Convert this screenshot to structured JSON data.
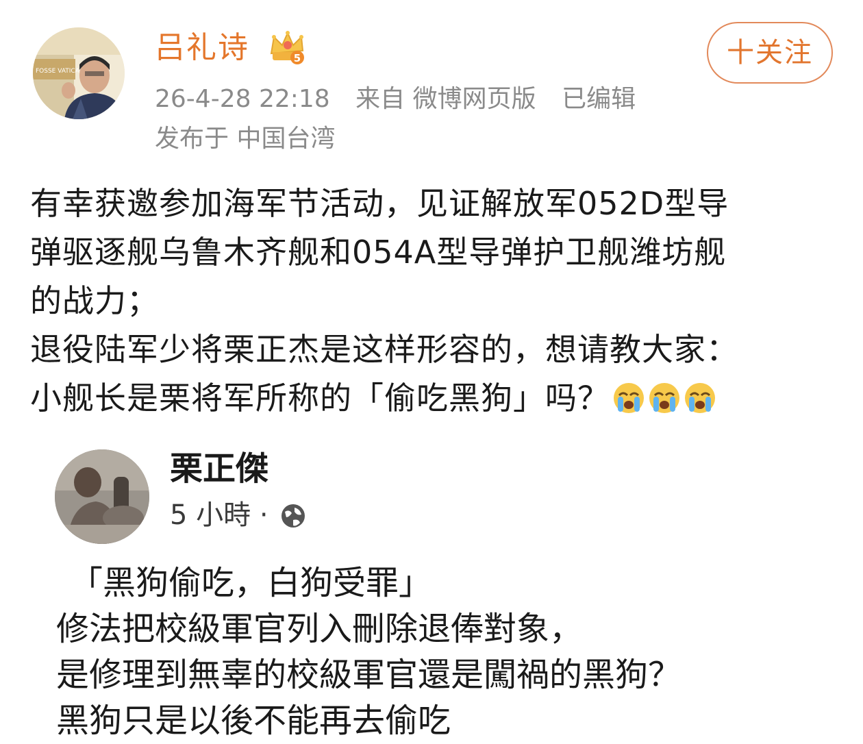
{
  "author": {
    "name": "吕礼诗",
    "badge": "crown-badge-icon",
    "badge_level": "5",
    "avatar_sign": "FOSSE VATICANI"
  },
  "follow_button": "十关注",
  "meta": {
    "datetime": "26-4-28 22:18",
    "source": "来自 微博网页版",
    "edited": "已编辑",
    "location": "发布于 中国台湾"
  },
  "post": {
    "lines": [
      "有幸获邀参加海军节活动，见证解放军052D型导",
      "弹驱逐舰乌鲁木齐舰和054A型导弹护卫舰潍坊舰",
      "的战力；",
      "退役陆军少将栗正杰是这样形容的，想请教大家：",
      "小舰长是栗将军所称的「偷吃黑狗」吗？"
    ],
    "emoji": "crying-face-icon"
  },
  "embedded": {
    "name": "栗正傑",
    "time": "5 小時 ·",
    "privacy": "globe-icon",
    "lines": [
      "「黑狗偷吃，白狗受罪」",
      "修法把校級軍官列入刪除退俸對象，",
      "是修理到無辜的校級軍官還是闖禍的黑狗？",
      "黑狗只是以後不能再去偷吃"
    ]
  },
  "colors": {
    "author_name": "#e4762b",
    "follow_border": "#e2895a",
    "meta_gray": "#8a8a8a",
    "text": "#1a1a1a"
  }
}
